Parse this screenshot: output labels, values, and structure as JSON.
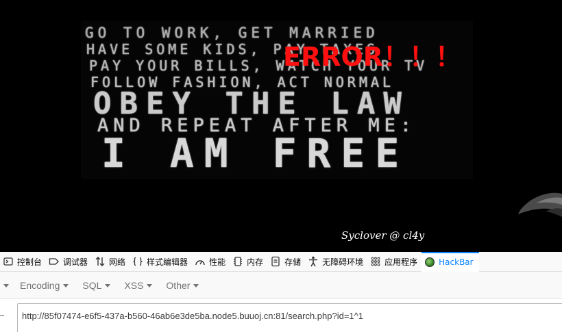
{
  "web": {
    "poster_lines": [
      "go to work, get married",
      "have some kids, pay taxes",
      "pay your bills, watch your tv",
      "follow fashion, act normal",
      "obey the law",
      "and repeat after me:",
      "i am free"
    ],
    "error_text": "ERROR！！！",
    "error_color": "#ff1010",
    "signature": "Syclover @ cl4y"
  },
  "devtools": {
    "tabs": [
      {
        "label": "控制台",
        "icon": "console-icon"
      },
      {
        "label": "调试器",
        "icon": "debugger-icon"
      },
      {
        "label": "网络",
        "icon": "network-icon"
      },
      {
        "label": "样式编辑器",
        "icon": "style-editor-icon"
      },
      {
        "label": "性能",
        "icon": "performance-icon"
      },
      {
        "label": "内存",
        "icon": "memory-icon"
      },
      {
        "label": "存储",
        "icon": "storage-icon"
      },
      {
        "label": "无障碍环境",
        "icon": "accessibility-icon"
      },
      {
        "label": "应用程序",
        "icon": "application-icon"
      },
      {
        "label": "HackBar",
        "icon": "hackbar-icon"
      }
    ],
    "selected_tab": "HackBar",
    "accent_color": "#0a84ff"
  },
  "hackbar": {
    "menus": [
      "Encoding",
      "SQL",
      "XSS",
      "Other"
    ],
    "url_value": "http://85f07474-e6f5-437a-b560-46ab6e3de5ba.node5.buuoj.cn:81/search.php?id=1^1"
  }
}
